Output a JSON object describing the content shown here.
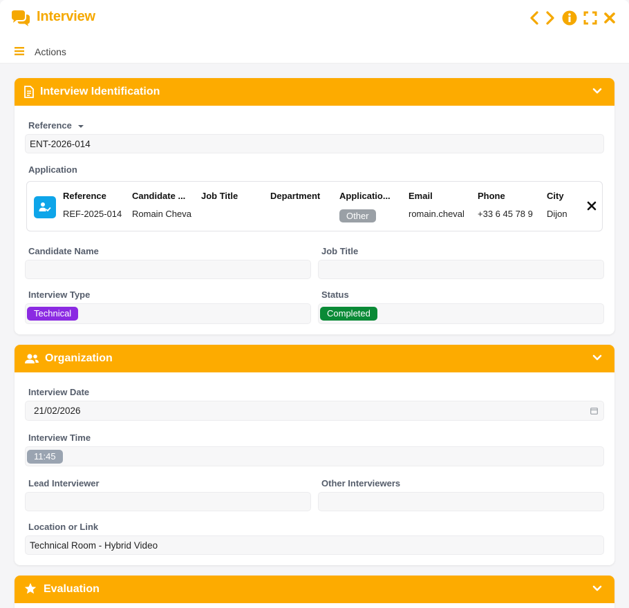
{
  "window": {
    "title": "Interview"
  },
  "toolbar": {
    "actions_label": "Actions"
  },
  "colors": {
    "accent": "#fdab00",
    "technical": "#8b2be2",
    "completed": "#0a8a36",
    "other": "#9aa0a6",
    "time_badge": "#9aa4b1"
  },
  "identification": {
    "title": "Interview Identification",
    "reference_label": "Reference",
    "reference_value": "ENT-2026-014",
    "application_label": "Application",
    "application": {
      "headers": [
        "Reference",
        "Candidate ...",
        "Job Title",
        "Department",
        "Applicatio...",
        "Email",
        "Phone",
        "City"
      ],
      "reference": "REF-2025-014",
      "candidate": "Romain Cheva",
      "job_title": "",
      "department": "",
      "application_status": "Other",
      "email": "romain.cheval",
      "phone": "+33 6 45 78 9",
      "city": "Dijon"
    },
    "candidate_name_label": "Candidate Name",
    "candidate_name_value": "",
    "job_title_label": "Job Title",
    "job_title_value": "",
    "interview_type_label": "Interview Type",
    "interview_type_value": "Technical",
    "status_label": "Status",
    "status_value": "Completed"
  },
  "organization": {
    "title": "Organization",
    "date_label": "Interview Date",
    "date_value": "21/02/2026",
    "time_label": "Interview Time",
    "time_value": "11:45",
    "lead_label": "Lead Interviewer",
    "lead_value": "",
    "others_label": "Other Interviewers",
    "others_value": "",
    "location_label": "Location or Link",
    "location_value": "Technical Room - Hybrid Video"
  },
  "evaluation": {
    "title": "Evaluation"
  }
}
